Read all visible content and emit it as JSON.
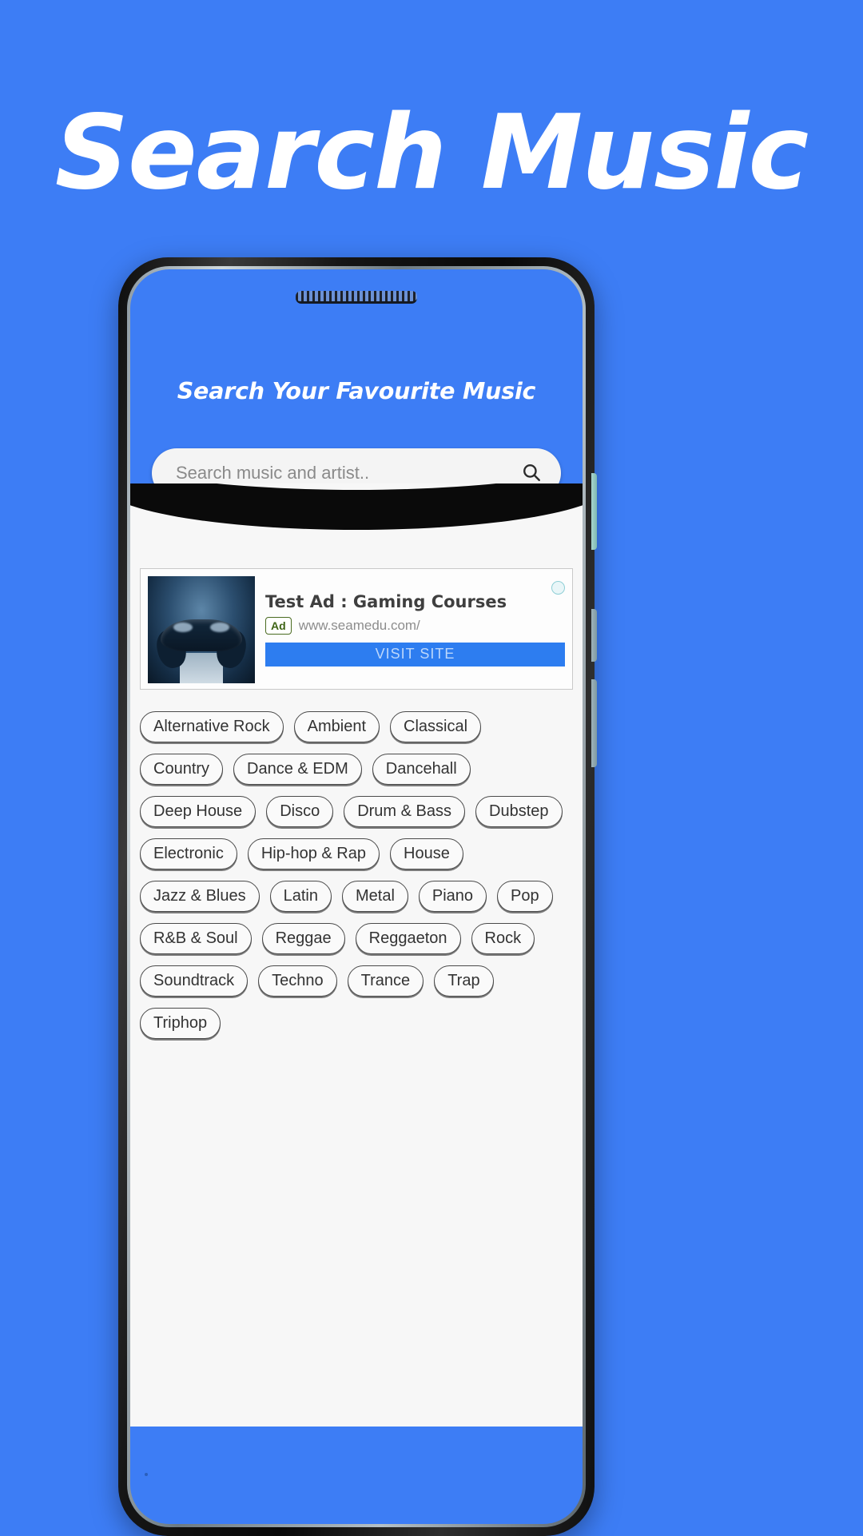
{
  "promo": {
    "title": "Search Music",
    "background_color": "#3d7df5"
  },
  "app": {
    "header_title": "Search Your Favourite Music",
    "search": {
      "placeholder": "Search music and artist..",
      "value": "",
      "icon": "search-icon"
    },
    "ad": {
      "title": "Test Ad : Gaming Courses",
      "badge": "Ad",
      "url": "www.seamedu.com/",
      "cta_label": "VISIT SITE",
      "close_icon": "ad-choices-icon",
      "thumbnail_alt": "gamepad-image"
    },
    "genres": {
      "rows": [
        [
          "Alternative Rock",
          "Ambient",
          "Classical"
        ],
        [
          "Country",
          "Dance & EDM",
          "Dancehall"
        ],
        [
          "Deep House",
          "Disco",
          "Drum & Bass",
          "Dubstep"
        ],
        [
          "Electronic",
          "Hip-hop & Rap",
          "House"
        ],
        [
          "Jazz & Blues",
          "Latin",
          "Metal",
          "Piano",
          "Pop"
        ],
        [
          "R&B & Soul",
          "Reggae",
          "Reggaeton",
          "Rock"
        ],
        [
          "Soundtrack",
          "Techno",
          "Trance",
          "Trap"
        ],
        [
          "Triphop"
        ]
      ]
    }
  },
  "colors": {
    "accent": "#3d7df5",
    "ad_button": "#2d7df0",
    "sheet": "#f7f7f7"
  }
}
